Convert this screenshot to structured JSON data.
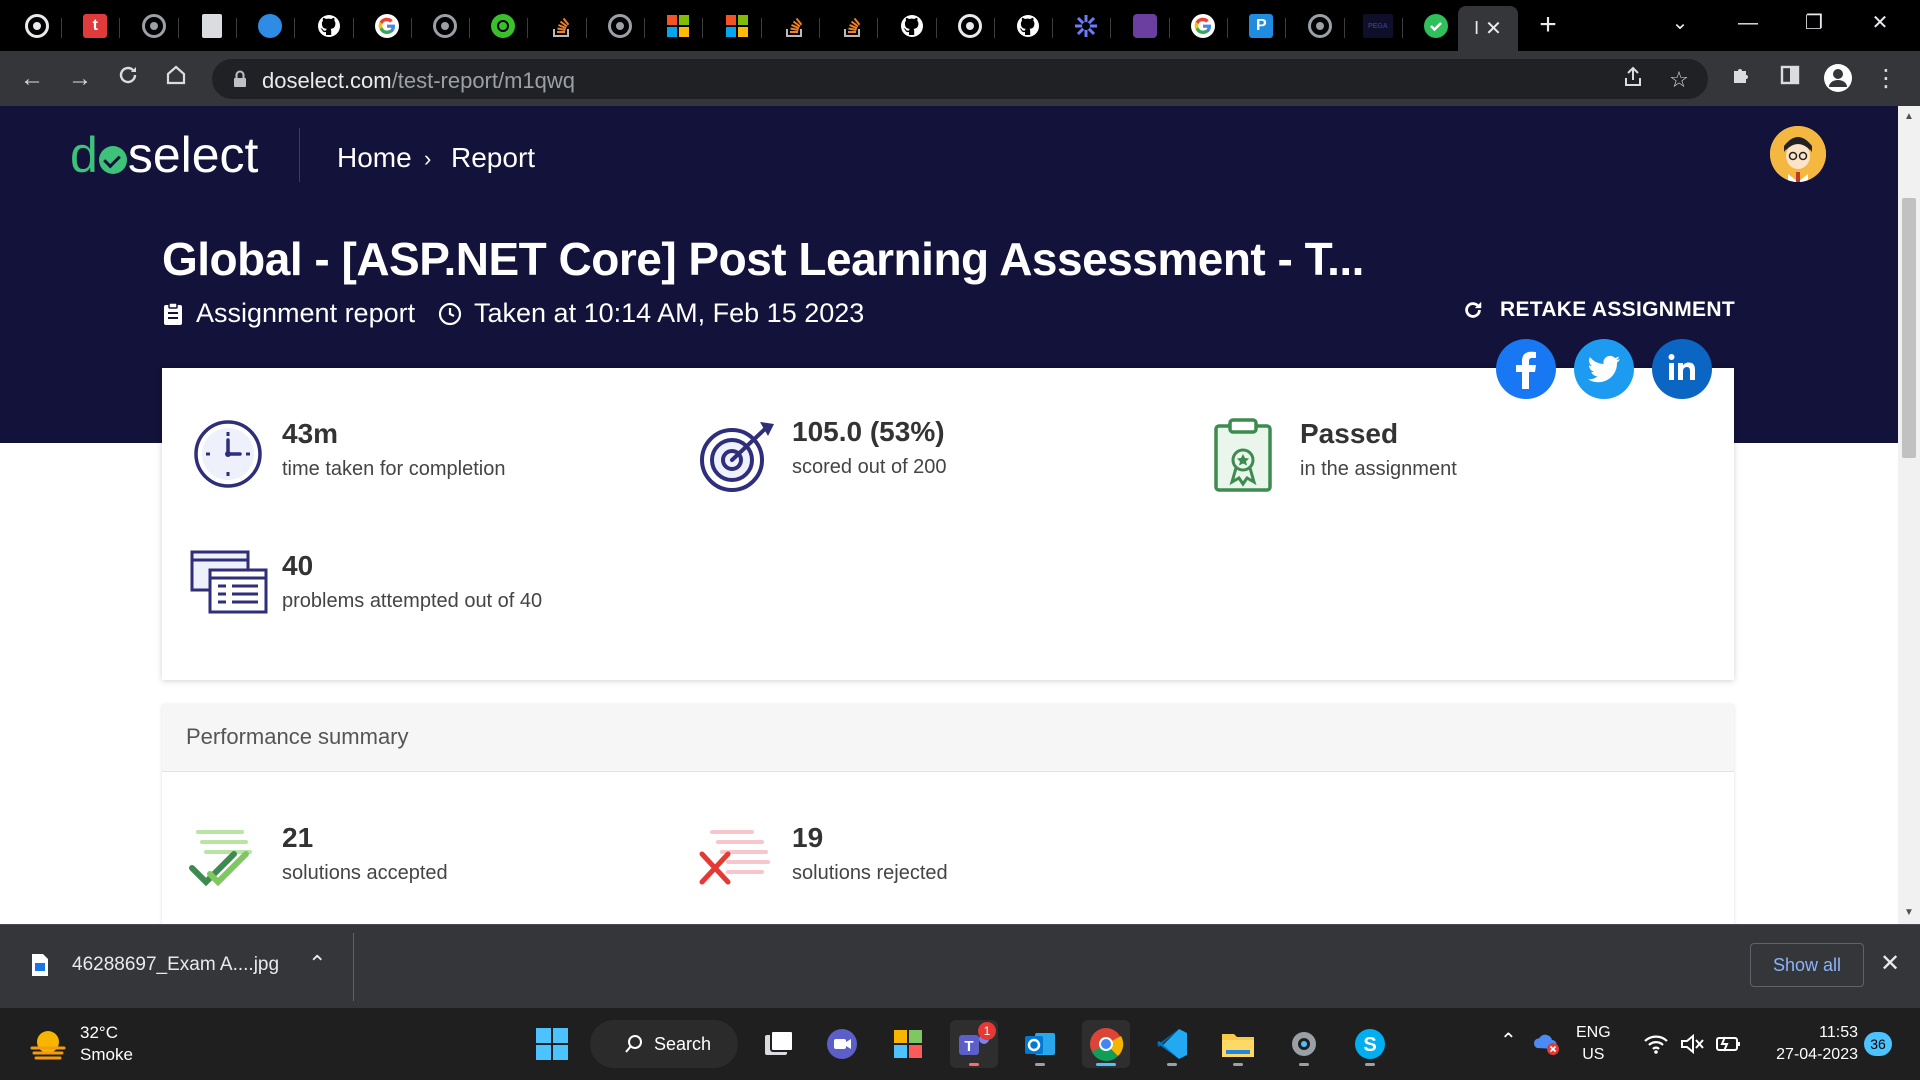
{
  "browser": {
    "tabs": [
      {
        "icon": "chrome-icon",
        "color": "#e8eaed"
      },
      {
        "icon": "trello-t-icon",
        "color": "#e03b3b",
        "letter": "t"
      },
      {
        "icon": "globe-icon",
        "color": "#9aa0a6"
      },
      {
        "icon": "doc-icon",
        "color": "#dadce0"
      },
      {
        "icon": "edge-cloud-icon",
        "color": "#2f8ce4"
      },
      {
        "icon": "github-icon",
        "color": "#ffffff"
      },
      {
        "icon": "google-icon",
        "color": "#ffffff"
      },
      {
        "icon": "globe-icon",
        "color": "#9aa0a6"
      },
      {
        "icon": "green-app-icon",
        "color": "#39c12c"
      },
      {
        "icon": "stackoverflow-icon",
        "color": "#f48024"
      },
      {
        "icon": "globe-icon",
        "color": "#9aa0a6"
      },
      {
        "icon": "microsoft-icon",
        "color": "#f35325"
      },
      {
        "icon": "microsoft-icon",
        "color": "#f35325"
      },
      {
        "icon": "stackoverflow-icon",
        "color": "#f48024"
      },
      {
        "icon": "stackoverflow-icon",
        "color": "#f48024"
      },
      {
        "icon": "github-icon",
        "color": "#ffffff"
      },
      {
        "icon": "chrome-icon",
        "color": "#e8eaed"
      },
      {
        "icon": "github-icon",
        "color": "#ffffff"
      },
      {
        "icon": "purple-gear-icon",
        "color": "#6b7cff"
      },
      {
        "icon": "square-app-icon",
        "color": "#6a3fa0"
      },
      {
        "icon": "google-icon",
        "color": "#ffffff"
      },
      {
        "icon": "p-app-icon",
        "color": "#1f8ce0",
        "letter": "P"
      },
      {
        "icon": "globe-icon",
        "color": "#9aa0a6"
      },
      {
        "icon": "pega-icon",
        "color": "#2d3a8c",
        "letter": "PEGA"
      },
      {
        "icon": "green-check-icon",
        "color": "#2fbf5b"
      }
    ],
    "active_tab_title": "I",
    "url_host": "doselect.com",
    "url_path": "/test-report/m1qwq"
  },
  "nav": {
    "logo_prefix": "d",
    "logo_suffix": "select",
    "home": "Home",
    "report": "Report"
  },
  "report": {
    "title": "Global - [ASP.NET Core] Post Learning Assessment - T...",
    "type_label": "Assignment report",
    "taken_at": "Taken at 10:14 AM, Feb 15 2023",
    "retake_label": "RETAKE ASSIGNMENT"
  },
  "social": [
    {
      "name": "facebook",
      "color": "#1877f2"
    },
    {
      "name": "twitter",
      "color": "#1d9bf0"
    },
    {
      "name": "linkedin",
      "color": "#0a66c2"
    }
  ],
  "stats": {
    "time": {
      "value": "43m",
      "label": "time taken for completion"
    },
    "score": {
      "value": "105.0 (53%)",
      "label": "scored out of 200"
    },
    "result": {
      "value": "Passed",
      "label": "in the assignment"
    },
    "problems": {
      "value": "40",
      "label": "problems attempted out of 40"
    }
  },
  "performance": {
    "title": "Performance summary",
    "accepted": {
      "value": "21",
      "label": "solutions accepted"
    },
    "rejected": {
      "value": "19",
      "label": "solutions rejected"
    }
  },
  "download": {
    "filename": "46288697_Exam A....jpg",
    "show_all": "Show all"
  },
  "taskbar": {
    "temperature": "32°C",
    "condition": "Smoke",
    "search": "Search",
    "teams_badge": "1",
    "lang": "ENG",
    "region": "US",
    "time": "11:53",
    "date": "27-04-2023",
    "notifications": "36"
  },
  "colors": {
    "hero_bg": "#12123a",
    "brand_green": "#3ec27a",
    "icon_navy": "#2e2e7a",
    "icon_green": "#3d8b4f"
  }
}
